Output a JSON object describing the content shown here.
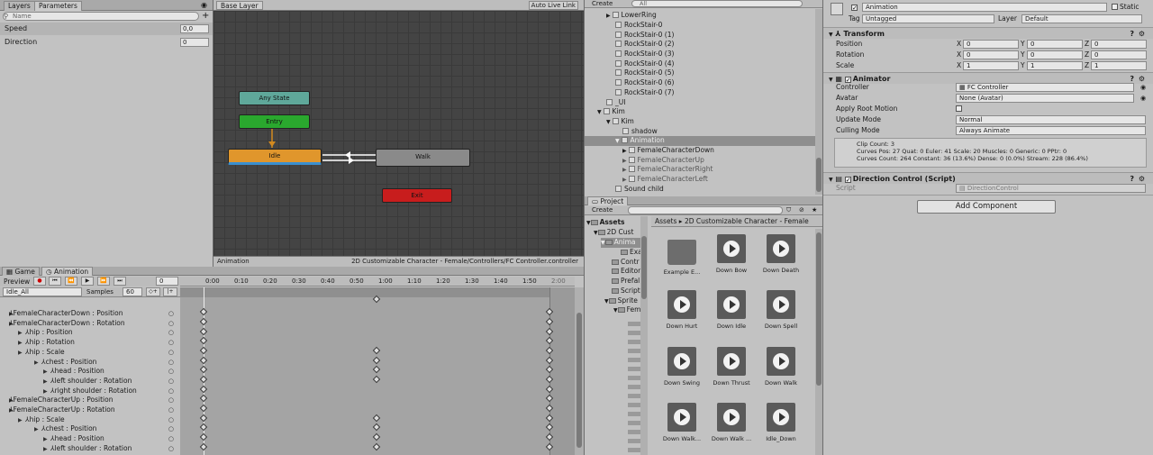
{
  "animator": {
    "tabs": [
      "Layers",
      "Parameters"
    ],
    "search_placeholder": "Name",
    "params": [
      {
        "name": "Speed",
        "value": "0,0"
      },
      {
        "name": "Direction",
        "value": "0"
      }
    ],
    "graph": {
      "title": "Base Layer",
      "auto_live": "Auto Live Link",
      "footer_left": "Animation",
      "footer_right": "2D Customizable Character - Female/Controllers/FC Controller.controller",
      "nodes": {
        "any": "Any State",
        "entry": "Entry",
        "idle": "Idle",
        "walk": "Walk",
        "exit": "Exit"
      }
    }
  },
  "animation": {
    "tabs": [
      "Game",
      "Animation"
    ],
    "preview": "Preview",
    "clip": "Idle_All",
    "samples_label": "Samples",
    "samples": "60",
    "frame": "0",
    "ruler": [
      "0:00",
      "0:10",
      "0:20",
      "0:30",
      "0:40",
      "0:50",
      "1:00",
      "1:10",
      "1:20",
      "1:30",
      "1:40",
      "1:50",
      "2:00"
    ],
    "props": [
      "FemaleCharacterDown : Position",
      "FemaleCharacterDown : Rotation",
      "hip : Position",
      "hip : Rotation",
      "hip : Scale",
      "chest : Position",
      "head : Position",
      "left shoulder : Rotation",
      "right shoulder : Rotation",
      "FemaleCharacterUp : Position",
      "FemaleCharacterUp : Rotation",
      "hip : Scale",
      "chest : Position",
      "head : Position",
      "left shoulder : Rotation"
    ]
  },
  "hierarchy": {
    "create": "Create",
    "search_placeholder": "All",
    "items": [
      "LowerRing",
      "RockStair-0",
      "RockStair-0 (1)",
      "RockStair-0 (2)",
      "RockStair-0 (3)",
      "RockStair-0 (4)",
      "RockStair-0 (5)",
      "RockStair-0 (6)",
      "RockStair-0 (7)",
      "_UI",
      "Kim",
      "Kim",
      "shadow",
      "Animation",
      "FemaleCharacterDown",
      "FemaleCharacterUp",
      "FemaleCharacterRight",
      "FemaleCharacterLeft",
      "Sound child"
    ]
  },
  "project": {
    "tab": "Project",
    "create": "Create",
    "breadcrumb": [
      "Assets",
      "2D Customizable Character - Female"
    ],
    "tree": [
      "Assets",
      "2D Cust",
      "Anima",
      "Exa",
      "Contr",
      "Editor",
      "Prefal",
      "Script",
      "Sprite",
      "Fem"
    ],
    "assets": [
      "Example E...",
      "Down Bow",
      "Down Death",
      "Down Hurt",
      "Down Idle",
      "Down Spell",
      "Down Swing",
      "Down Thrust",
      "Down Walk",
      "Down Walk...",
      "Down Walk ...",
      "Idle_Down"
    ]
  },
  "inspector": {
    "name": "Animation",
    "static": "Static",
    "tag_label": "Tag",
    "tag": "Untagged",
    "layer_label": "Layer",
    "layer": "Default",
    "transform": {
      "title": "Transform",
      "rows": [
        {
          "label": "Position",
          "x": "0",
          "y": "0",
          "z": "0"
        },
        {
          "label": "Rotation",
          "x": "0",
          "y": "0",
          "z": "0"
        },
        {
          "label": "Scale",
          "x": "1",
          "y": "1",
          "z": "1"
        }
      ]
    },
    "animator": {
      "title": "Animator",
      "controller_label": "Controller",
      "controller": "FC Controller",
      "avatar_label": "Avatar",
      "avatar": "None (Avatar)",
      "root_motion": "Apply Root Motion",
      "update_label": "Update Mode",
      "update": "Normal",
      "culling_label": "Culling Mode",
      "culling": "Always Animate",
      "info1": "Clip Count: 3",
      "info2": "Curves Pos: 27 Quat: 0 Euler: 41 Scale: 20 Muscles: 0 Generic: 0 PPtr: 0",
      "info3": "Curves Count: 264 Constant: 36 (13.6%) Dense: 0 (0.0%) Stream: 228 (86.4%)"
    },
    "script": {
      "title": "Direction Control (Script)",
      "label": "Script",
      "value": "DirectionControl"
    },
    "add_component": "Add Component"
  },
  "colors": {
    "any": "#5fa89a",
    "entry": "#2aa82e",
    "idle": "#e0962c",
    "walk": "#8a8a8a",
    "exit": "#c81d1d",
    "selected": "#8e8e8e"
  }
}
